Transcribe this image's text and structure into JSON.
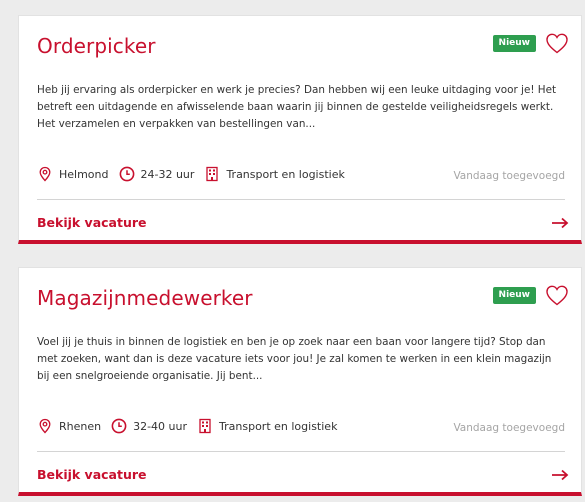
{
  "colors": {
    "brand": "#c8102e",
    "badge": "#2e9e4f",
    "muted_text": "#a5a5a5",
    "body_text": "#333333"
  },
  "jobs": [
    {
      "title": "Orderpicker",
      "badge": "Nieuw",
      "description": "Heb jij ervaring als orderpicker en werk je precies? Dan hebben wij een leuke uitdaging voor je! Het betreft een uitdagende en afwisselende baan waarin jij binnen de gestelde veiligheidsregels werkt. Het verzamelen en verpakken van bestellingen van...",
      "location": "Helmond",
      "hours": "24-32 uur",
      "category": "Transport en logistiek",
      "added": "Vandaag toegevoegd",
      "link_label": "Bekijk vacature"
    },
    {
      "title": "Magazijnmedewerker",
      "badge": "Nieuw",
      "description": "Voel jij je thuis in binnen de logistiek en ben je op zoek naar een baan voor langere tijd? Stop dan met zoeken, want dan is deze vacature iets voor jou! Je zal komen te werken in een klein magazijn bij een snelgroeiende organisatie. Jij bent...",
      "location": "Rhenen",
      "hours": "32-40 uur",
      "category": "Transport en logistiek",
      "added": "Vandaag toegevoegd",
      "link_label": "Bekijk vacature"
    }
  ],
  "icons": {
    "favorite": "heart-icon",
    "location": "location-pin-icon",
    "hours": "clock-icon",
    "category": "building-icon",
    "link": "arrow-right-icon"
  }
}
